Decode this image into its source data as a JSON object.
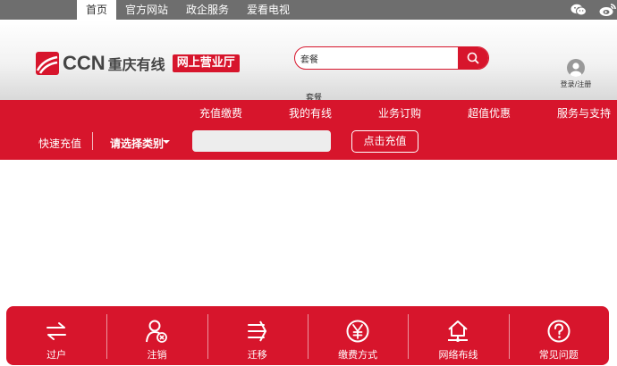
{
  "top_nav": {
    "items": [
      "首页",
      "官方网站",
      "政企服务",
      "爱看电视"
    ],
    "active_index": 0
  },
  "social": {
    "icons": [
      "wechat-icon",
      "weibo-icon"
    ]
  },
  "logo": {
    "brand": "CCN",
    "name": "重庆有线",
    "badge": "网上营业厅"
  },
  "search": {
    "value": "套餐",
    "hot_word": "套餐"
  },
  "user": {
    "login_label": "登录/注册"
  },
  "main_nav": {
    "items": [
      "充值缴费",
      "我的有线",
      "业务订购",
      "超值优惠",
      "服务与支持"
    ]
  },
  "quick_recharge": {
    "label": "快速充值",
    "select_label": "请选择类别",
    "input_value": "",
    "button_label": "点击充值"
  },
  "bottom_bar": {
    "items": [
      {
        "label": "过户",
        "icon": "transfer-arrows-icon"
      },
      {
        "label": "注销",
        "icon": "user-cancel-icon"
      },
      {
        "label": "迁移",
        "icon": "move-arrows-icon"
      },
      {
        "label": "缴费方式",
        "icon": "yen-icon"
      },
      {
        "label": "网络布线",
        "icon": "house-network-icon"
      },
      {
        "label": "常见问题",
        "icon": "question-icon"
      }
    ]
  },
  "colors": {
    "brand_red": "#d7152c",
    "top_bar_gray": "#6e6e6e"
  }
}
